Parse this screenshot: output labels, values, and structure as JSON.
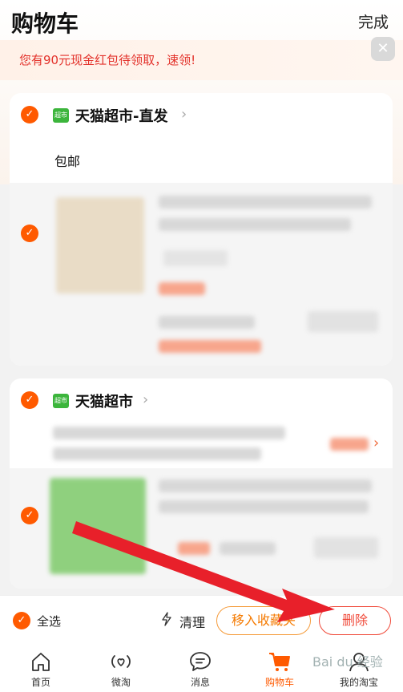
{
  "header": {
    "title": "购物车",
    "done_label": "完成"
  },
  "promo": {
    "text": "您有90元现金红包待领取，速领!",
    "close_icon": "✕"
  },
  "shops": [
    {
      "name": "天猫超市-直发",
      "badge": "超市",
      "shipping": "包邮"
    },
    {
      "name": "天猫超市",
      "badge": "超市"
    }
  ],
  "bottom_bar": {
    "select_all_label": "全选",
    "clean_label": "清理",
    "move_to_fav_label": "移入收藏夹",
    "delete_label": "删除"
  },
  "tabs": [
    {
      "label": "首页",
      "icon": "home-icon"
    },
    {
      "label": "微淘",
      "icon": "broadcast-icon"
    },
    {
      "label": "消息",
      "icon": "message-icon"
    },
    {
      "label": "购物车",
      "icon": "cart-icon",
      "active": true
    },
    {
      "label": "我的淘宝",
      "icon": "profile-icon"
    }
  ],
  "watermark": "Bai du 经验",
  "colors": {
    "accent": "#ff5a00",
    "delete": "#f04a3a",
    "fav": "#f59b3a",
    "arrow": "#e8202a"
  }
}
